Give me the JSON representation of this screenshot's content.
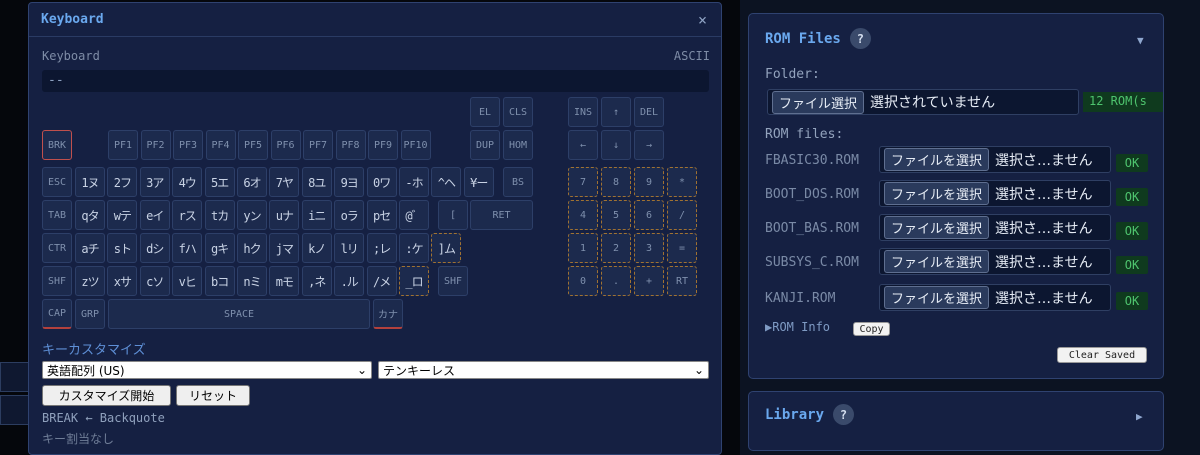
{
  "keyboard": {
    "window_title": "Keyboard",
    "close": "×",
    "label": "Keyboard",
    "mode": "ASCII",
    "display": "--",
    "keys": {
      "el": "EL",
      "cls": "CLS",
      "ins": "INS",
      "up": "↑",
      "del": "DEL",
      "brk": "BRK",
      "pf1": "PF1",
      "pf2": "PF2",
      "pf3": "PF3",
      "pf4": "PF4",
      "pf5": "PF5",
      "pf6": "PF6",
      "pf7": "PF7",
      "pf8": "PF8",
      "pf9": "PF9",
      "pf10": "PF10",
      "dup": "DUP",
      "hom": "HOM",
      "left": "←",
      "down": "↓",
      "right": "→",
      "esc": "ESC",
      "bs": "BS",
      "tab": "TAB",
      "bracket": "[",
      "ret": "RET",
      "ctr": "CTR",
      "shf": "SHF",
      "shf2": "SHF",
      "cap": "CAP",
      "grp": "GRP",
      "space": "SPACE",
      "kana": "カナ"
    },
    "row1_glyphs": [
      "1ヌ",
      "2フ",
      "3ア",
      "4ウ",
      "5エ",
      "6オ",
      "7ヤ",
      "8ユ",
      "9ヨ",
      "0ワ",
      "-ホ",
      "^ヘ",
      "¥ー"
    ],
    "row2_glyphs": [
      "qタ",
      "wテ",
      "eイ",
      "rス",
      "tカ",
      "yン",
      "uナ",
      "iニ",
      "oラ",
      "pセ",
      "@゛"
    ],
    "row3_glyphs": [
      "aチ",
      "sト",
      "dシ",
      "fハ",
      "gキ",
      "hク",
      "jマ",
      "kノ",
      "lリ",
      ";レ",
      ":ケ",
      "]ム"
    ],
    "row4_glyphs": [
      "zツ",
      "xサ",
      "cソ",
      "vヒ",
      "bコ",
      "nミ",
      "mモ",
      ",ネ",
      ".ル",
      "/メ",
      "_ロ"
    ],
    "numpad": [
      "7",
      "8",
      "9",
      "*",
      "4",
      "5",
      "6",
      "/",
      "1",
      "2",
      "3",
      "=",
      "0",
      ".",
      "+",
      "RT"
    ],
    "custom_label": "キーカスタマイズ",
    "layout_select": "英語配列 (US)",
    "tenkey_select": "テンキーレス",
    "start_button": "カスタマイズ開始",
    "reset_button": "リセット",
    "mapping": "BREAK ← Backquote",
    "mapping_none": "キー割当なし"
  },
  "rom": {
    "title": "ROM Files",
    "help": "?",
    "collapse": "▼",
    "folder_label": "Folder:",
    "folder_button": "ファイル選択",
    "folder_status": "選択されていません",
    "count": "12 ROM(s",
    "files_label": "ROM files:",
    "file_button": "ファイルを選択",
    "file_status": "選択さ…ません",
    "files": [
      {
        "name": "FBASIC30.ROM",
        "status": "OK"
      },
      {
        "name": "BOOT_DOS.ROM",
        "status": "OK"
      },
      {
        "name": "BOOT_BAS.ROM",
        "status": "OK"
      },
      {
        "name": "SUBSYS_C.ROM",
        "status": "OK"
      },
      {
        "name": "KANJI.ROM",
        "status": "OK"
      }
    ],
    "info": "▶ROM Info",
    "copy": "Copy",
    "clear": "Clear Saved"
  },
  "library": {
    "title": "Library",
    "help": "?",
    "expand": "▶"
  }
}
